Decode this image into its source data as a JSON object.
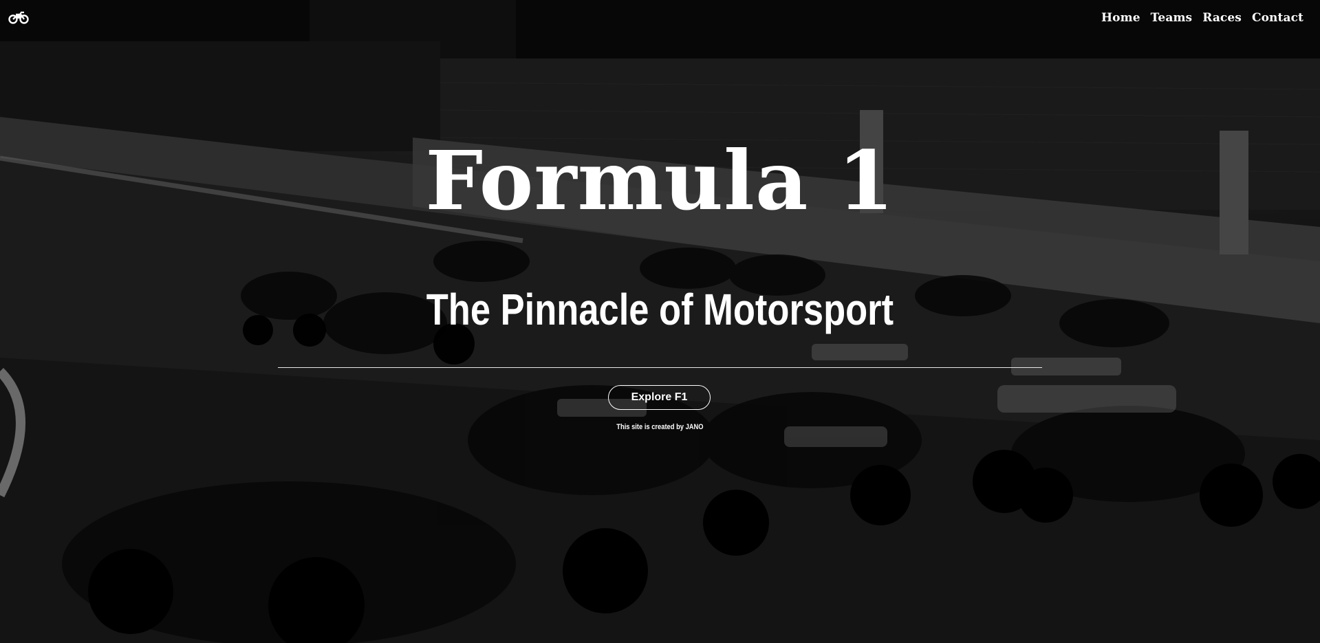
{
  "header": {
    "logo_icon": "motorcycle-icon",
    "nav": [
      {
        "label": "Home"
      },
      {
        "label": "Teams"
      },
      {
        "label": "Races"
      },
      {
        "label": "Contact"
      }
    ]
  },
  "hero": {
    "title": "Formula 1",
    "subtitle": "The Pinnacle of Motorsport",
    "cta_label": "Explore F1",
    "credit": "This site is created by JANO"
  },
  "colors": {
    "text": "#ffffff",
    "overlay": "#000000"
  }
}
